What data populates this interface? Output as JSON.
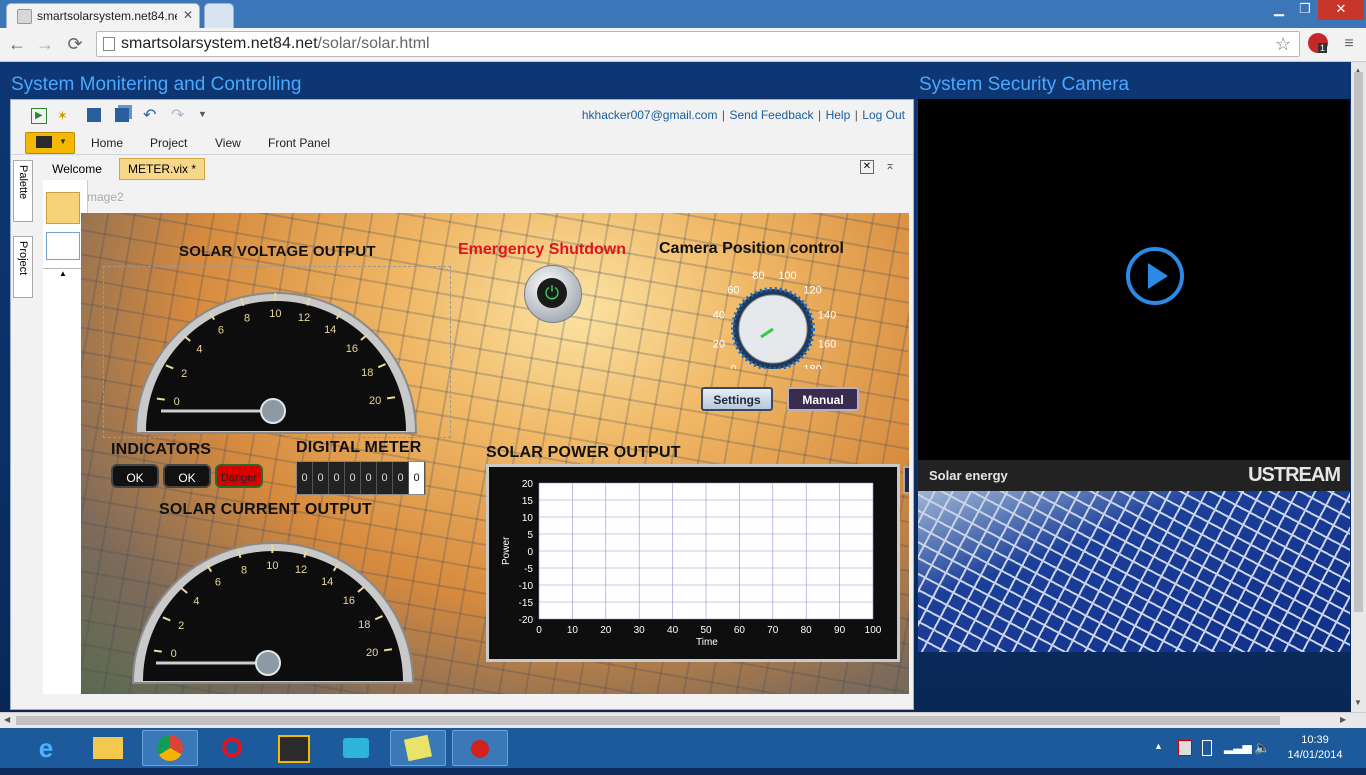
{
  "browser": {
    "tab_title": "smartsolarsystem.net84.ne",
    "url_host": "smartsolarsystem.net84.net",
    "url_path": "/solar/solar.html",
    "back_icon": "back-arrow-icon",
    "forward_icon": "forward-arrow-icon",
    "reload_icon": "reload-icon",
    "bookmark_icon": "star-icon",
    "menu_icon": "hamburger-menu-icon",
    "extension_badge": "1"
  },
  "page": {
    "left_title": "System Monitering and Controlling",
    "right_title": "System Security Camera"
  },
  "labview": {
    "header_links": {
      "email": "hkhacker007@gmail.com",
      "feedback": "Send Feedback",
      "help": "Help",
      "logout": "Log Out",
      "sep": "|"
    },
    "ribbon_tabs": [
      "Home",
      "Project",
      "View",
      "Front Panel"
    ],
    "doc_tabs": [
      "Welcome",
      "METER.vix *"
    ],
    "side_tabs": [
      "Palette",
      "Project"
    ],
    "image_label": "mage2",
    "voltage": {
      "title": "SOLAR VOLTAGE OUTPUT",
      "ticks": [
        "0",
        "2",
        "4",
        "6",
        "8",
        "10",
        "12",
        "14",
        "16",
        "18",
        "20"
      ],
      "value": 0
    },
    "current": {
      "title": "SOLAR CURRENT OUTPUT",
      "ticks": [
        "0",
        "2",
        "4",
        "6",
        "8",
        "10",
        "12",
        "14",
        "16",
        "18",
        "20"
      ],
      "value": 0
    },
    "emergency": {
      "title": "Emergency Shutdown",
      "icon": "power-icon"
    },
    "camera_control": {
      "title": "Camera Position control",
      "ticks": [
        "0",
        "20",
        "40",
        "60",
        "80",
        "100",
        "120",
        "140",
        "160",
        "180"
      ],
      "settings_label": "Settings",
      "manual_label": "Manual",
      "value": 10
    },
    "indicators": {
      "title": "INDICATORS",
      "buttons": [
        "OK",
        "OK",
        "Danger"
      ]
    },
    "digital_meter": {
      "title": "DIGITAL METER",
      "digits": [
        "0",
        "0",
        "0",
        "0",
        "0",
        "0",
        "0",
        "0"
      ]
    },
    "power_chart_title": "SOLAR POWER OUTPUT"
  },
  "chart_data": {
    "type": "line",
    "title": "SOLAR POWER OUTPUT",
    "xlabel": "Time",
    "ylabel": "Power",
    "xlim": [
      0,
      100
    ],
    "ylim": [
      -20,
      20
    ],
    "xticks": [
      "0",
      "10",
      "20",
      "30",
      "40",
      "50",
      "60",
      "70",
      "80",
      "90",
      "100"
    ],
    "yticks": [
      "20",
      "15",
      "10",
      "5",
      "0",
      "-5",
      "-10",
      "-15",
      "-20"
    ],
    "grid": true,
    "series": []
  },
  "camera": {
    "channel_title": "Solar energy",
    "brand": "USTREAM",
    "play_icon": "play-icon"
  },
  "taskbar": {
    "apps": [
      "ie-icon",
      "file-explorer-icon",
      "chrome-icon",
      "opera-icon",
      "labview-icon",
      "remote-desktop-icon",
      "sticky-notes-icon",
      "red-button-icon"
    ],
    "time": "10:39",
    "date": "14/01/2014"
  },
  "colors": {
    "accent_title": "#4aa8ff",
    "emergency_red": "#e0141e",
    "danger_red": "#d80000"
  }
}
